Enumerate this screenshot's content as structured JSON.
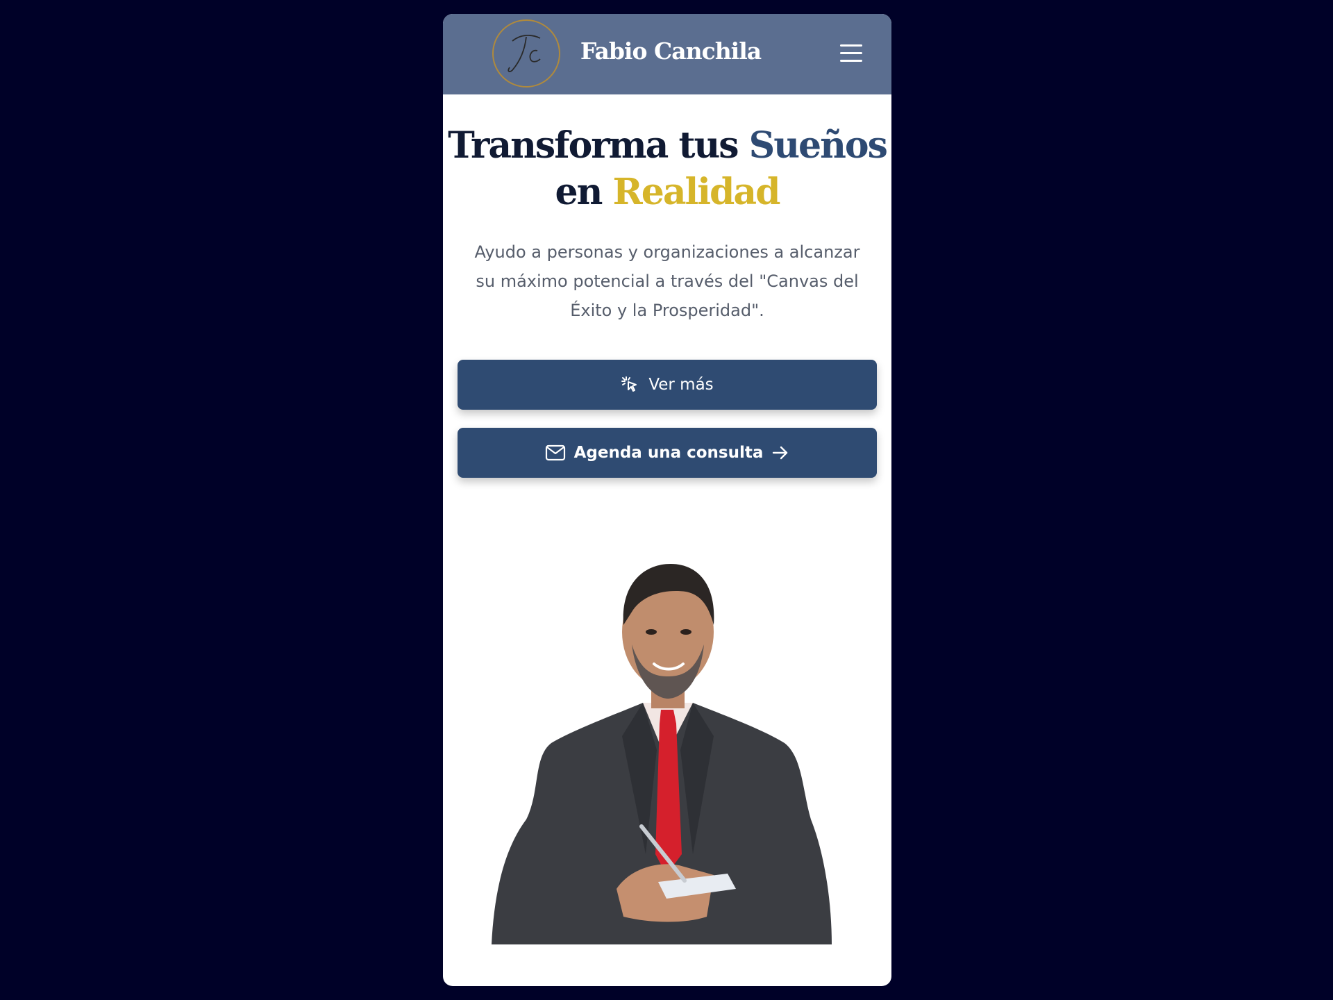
{
  "header": {
    "brand": "Fabio Canchila",
    "logo_text": "FC",
    "menu_icon": "hamburger-icon"
  },
  "hero": {
    "headline_part1": "Transforma tus ",
    "headline_blue": "Sueños",
    "headline_part2": "en ",
    "headline_gold": "Realidad",
    "lead": "Ayudo a personas y organizaciones a alcanzar su máximo potencial a través del \"Canvas del Éxito y la Prosperidad\"."
  },
  "buttons": {
    "primary_label": "Ver más",
    "primary_icon": "pointer-click-icon",
    "secondary_label": "Agenda una consulta",
    "secondary_icon_left": "mail-icon",
    "secondary_icon_right": "arrow-right-icon"
  },
  "colors": {
    "page_background": "#000128",
    "header_background": "#5b6e90",
    "button_background": "#2f4b72",
    "accent_blue": "#2e4a73",
    "accent_gold": "#d6b52a",
    "logo_gold": "#b08a3c"
  }
}
